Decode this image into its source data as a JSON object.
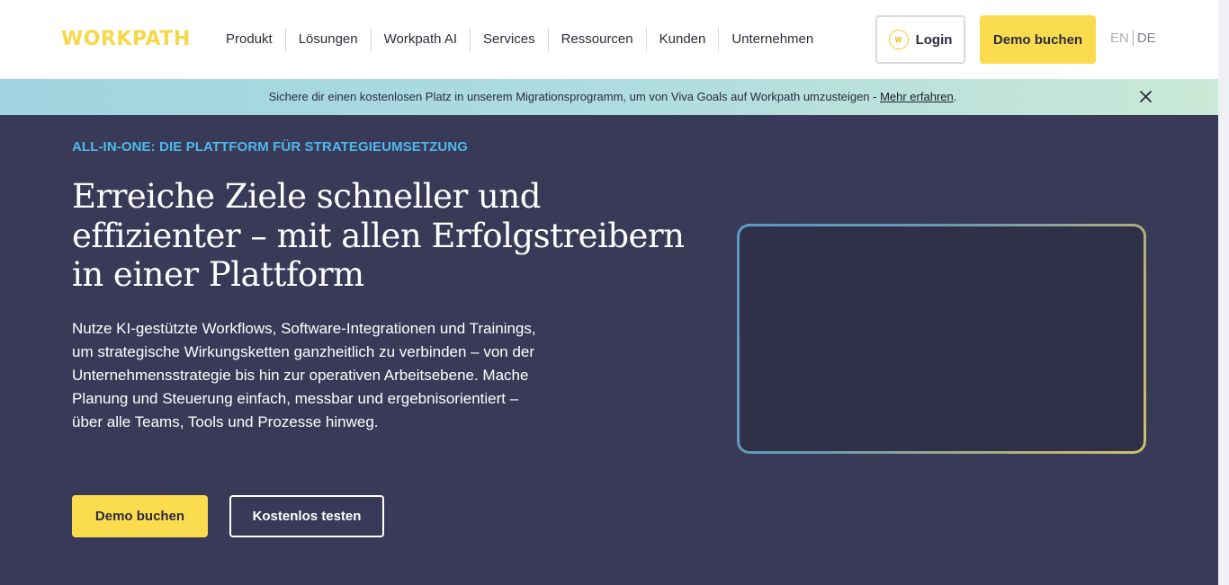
{
  "header": {
    "logo": "WORKPATH",
    "nav": [
      "Produkt",
      "Lösungen",
      "Workpath AI",
      "Services",
      "Ressourcen",
      "Kunden",
      "Unternehmen"
    ],
    "login_label": "Login",
    "login_icon_glyph": "W",
    "demo_label": "Demo buchen",
    "lang_en": "EN",
    "lang_de": "DE"
  },
  "banner": {
    "text": "Sichere dir einen kostenlosen Platz in unserem Migrationsprogramm, um von Viva Goals auf Workpath umzusteigen - ",
    "link": "Mehr erfahren",
    "suffix": "."
  },
  "hero": {
    "eyebrow": "ALL-IN-ONE: DIE PLATTFORM FÜR STRATEGIEUMSETZUNG",
    "headline": "Erreiche Ziele schneller und effizienter – mit allen Erfolgstreibern in einer Plattform",
    "body": "Nutze KI-gestützte Workflows, Software-Integrationen und Trainings, um strategische Wirkungsketten ganzheitlich zu verbinden – von der Unternehmensstrategie bis hin zur operativen Arbeitsebene. Mache Planung und Steuerung einfach, messbar und ergebnisorientiert – über alle Teams, Tools und Prozesse hinweg.",
    "cta_primary": "Demo buchen",
    "cta_secondary": "Kostenlos testen"
  },
  "colors": {
    "brand_yellow": "#fbdc4e",
    "hero_bg": "#383a57",
    "eyebrow_blue": "#4fb8ee"
  }
}
